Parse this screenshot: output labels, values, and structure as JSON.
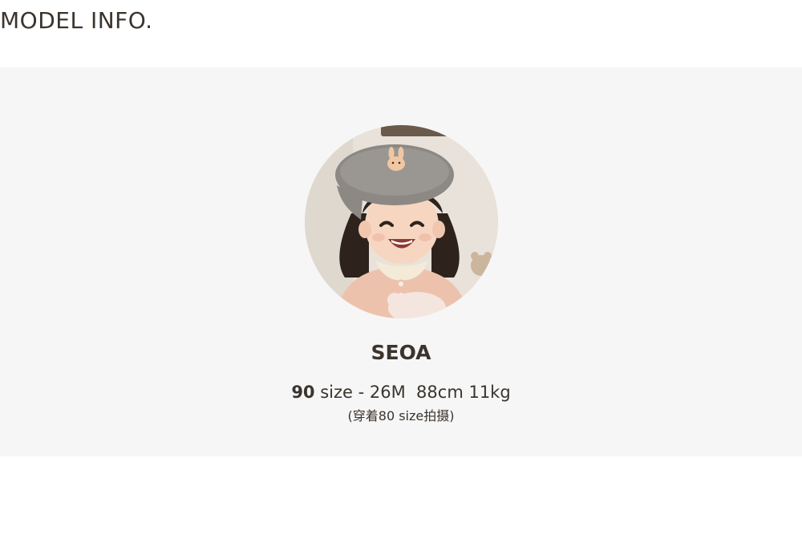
{
  "heading": "MODEL INFO.",
  "model": {
    "name": "SEOA",
    "size_number": "90",
    "size_details": " size - 26M  88cm 11kg",
    "note": "(穿着80 size拍摄)"
  },
  "colors": {
    "text": "#3b342e",
    "panel_background": "#f6f6f6"
  }
}
